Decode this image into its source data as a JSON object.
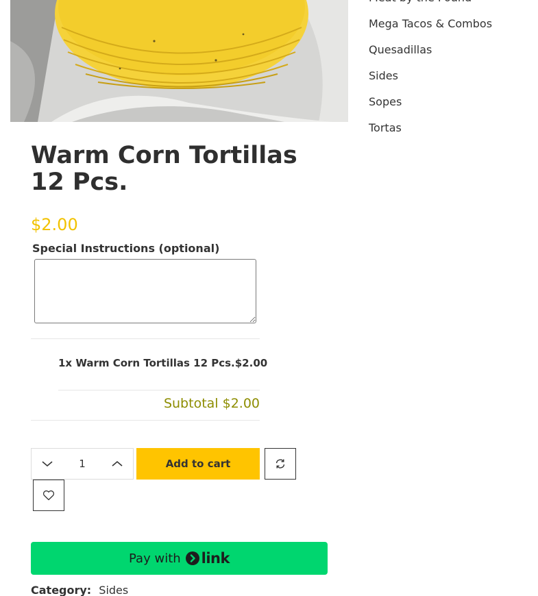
{
  "sidebar": {
    "items": [
      {
        "label": "Meat by the Pound"
      },
      {
        "label": "Mega Tacos & Combos"
      },
      {
        "label": "Quesadillas"
      },
      {
        "label": "Sides"
      },
      {
        "label": "Sopes"
      },
      {
        "label": "Tortas"
      }
    ]
  },
  "product": {
    "title": "Warm Corn Tortillas 12 Pcs.",
    "price": "$2.00",
    "instructions_label": "Special Instructions (optional)",
    "instructions_value": "",
    "line_item_name": "1x Warm Corn Tortillas 12 Pcs.",
    "line_item_price": "$2.00",
    "subtotal": "Subtotal $2.00",
    "quantity": "1",
    "add_to_cart_label": "Add to cart",
    "pay_with_label": "Pay with",
    "pay_brand": "link",
    "category_label": "Category:",
    "category_value": "Sides"
  },
  "colors": {
    "price": "#f2c200",
    "subtotal": "#8d8d00",
    "add_to_cart": "#ffc400",
    "pay_link": "#00d66f"
  },
  "icons": {
    "decrease": "chevron-down-icon",
    "increase": "chevron-up-icon",
    "compare": "refresh-icon",
    "wishlist": "heart-icon",
    "pay_brand": "link-arrow-icon"
  }
}
